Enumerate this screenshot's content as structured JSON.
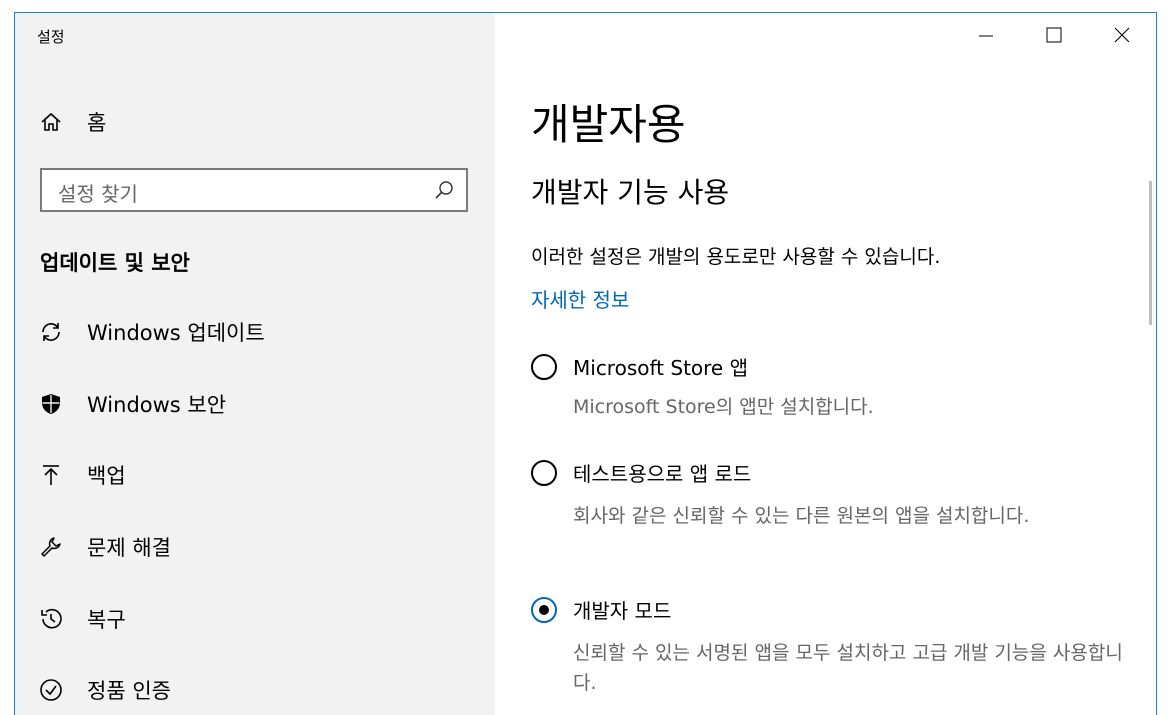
{
  "window": {
    "title": "설정"
  },
  "sidebar": {
    "home_label": "홈",
    "search_placeholder": "설정 찾기",
    "section_title": "업데이트 및 보안",
    "items": [
      {
        "label": "Windows 업데이트",
        "icon": "sync-icon"
      },
      {
        "label": "Windows 보안",
        "icon": "shield-icon"
      },
      {
        "label": "백업",
        "icon": "upload-arrow-icon"
      },
      {
        "label": "문제 해결",
        "icon": "wrench-icon"
      },
      {
        "label": "복구",
        "icon": "history-icon"
      },
      {
        "label": "정품 인증",
        "icon": "check-circle-icon"
      }
    ]
  },
  "main": {
    "page_title": "개발자용",
    "subtitle": "개발자 기능 사용",
    "description": "이러한 설정은 개발의 용도로만 사용할 수 있습니다.",
    "link": "자세한 정보",
    "options": [
      {
        "label": "Microsoft Store 앱",
        "description": "Microsoft Store의 앱만 설치합니다.",
        "selected": false
      },
      {
        "label": "테스트용으로 앱 로드",
        "description": "회사와 같은 신뢰할 수 있는 다른 원본의 앱을 설치합니다.",
        "selected": false
      },
      {
        "label": "개발자 모드",
        "description": "신뢰할 수 있는 서명된 앱을 모두 설치하고 고급 개발 기능을 사용합니다.",
        "selected": true
      }
    ]
  },
  "colors": {
    "accent": "#0067c0",
    "sidebar_bg": "#f2f2f2",
    "border": "#1883d7"
  }
}
